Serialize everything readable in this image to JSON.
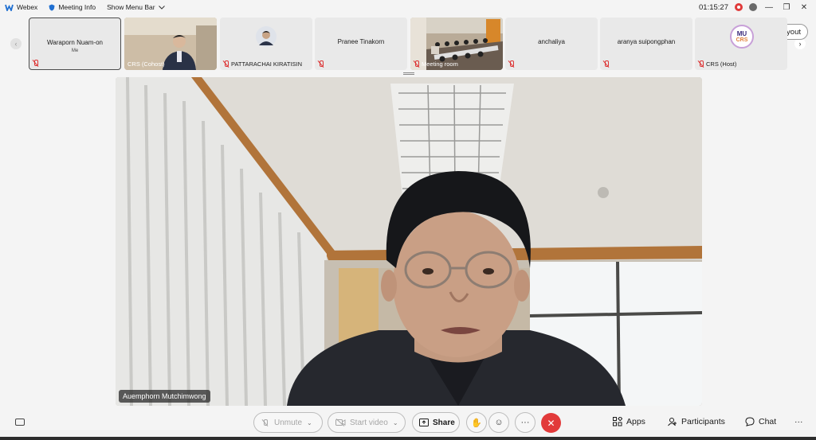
{
  "titlebar": {
    "app_name": "Webex",
    "meeting_info": "Meeting Info",
    "show_menu_bar": "Show Menu Bar",
    "timer": "01:15:27"
  },
  "filmstrip": {
    "tiles": [
      {
        "name": "Waraporn Nuam-on",
        "sub": "Me"
      },
      {
        "name": "CRS (Cohost)"
      },
      {
        "name": "PATTARACHAI KIRATISIN"
      },
      {
        "name": "Pranee Tinakorn"
      },
      {
        "name": "Meeting room"
      },
      {
        "name": "anchaliya"
      },
      {
        "name": "aranya suipongphan"
      },
      {
        "name": "CRS (Host)"
      }
    ],
    "layout_label": "Layout",
    "logo_text": "MU",
    "logo_sub": "CRS"
  },
  "main_video": {
    "speaker_name": "Auemphorn Mutchimwong"
  },
  "controls": {
    "unmute": "Unmute",
    "start_video": "Start video",
    "share": "Share",
    "apps": "Apps",
    "participants": "Participants",
    "chat": "Chat"
  },
  "colors": {
    "end_button": "#e23a3a",
    "mute_icon": "#dd3333",
    "recording": "#e03a3a"
  }
}
